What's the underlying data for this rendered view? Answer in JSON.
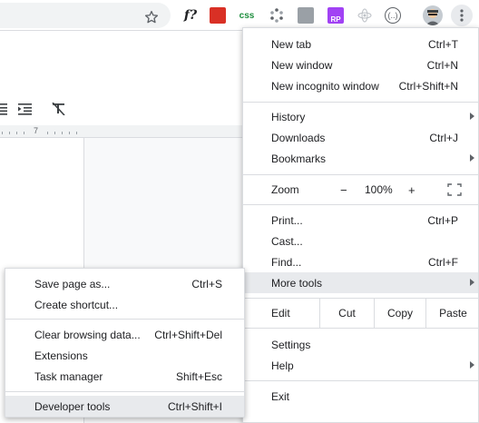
{
  "toolbar": {
    "extensions": [
      {
        "name": "formula-extension-icon",
        "text": "f?"
      },
      {
        "name": "red-book-extension-icon",
        "text": ""
      },
      {
        "name": "css-extension-icon",
        "text": "css"
      },
      {
        "name": "dots-extension-icon",
        "text": ""
      },
      {
        "name": "stack-extension-icon",
        "text": ""
      },
      {
        "name": "rp-extension-icon",
        "text": "RP"
      },
      {
        "name": "atom-extension-icon",
        "text": ""
      },
      {
        "name": "code-extension-icon",
        "text": "(..)"
      }
    ]
  },
  "doc": {
    "ruler_number": "7"
  },
  "menu": {
    "group1": [
      {
        "label": "New tab",
        "accel": "Ctrl+T"
      },
      {
        "label": "New window",
        "accel": "Ctrl+N"
      },
      {
        "label": "New incognito window",
        "accel": "Ctrl+Shift+N"
      }
    ],
    "group2": [
      {
        "label": "History",
        "accel": "",
        "submenu": true
      },
      {
        "label": "Downloads",
        "accel": "Ctrl+J"
      },
      {
        "label": "Bookmarks",
        "accel": "",
        "submenu": true
      }
    ],
    "zoom": {
      "label": "Zoom",
      "minus": "−",
      "value": "100%",
      "plus": "+"
    },
    "group3": [
      {
        "label": "Print...",
        "accel": "Ctrl+P"
      },
      {
        "label": "Cast...",
        "accel": ""
      },
      {
        "label": "Find...",
        "accel": "Ctrl+F"
      },
      {
        "label": "More tools",
        "accel": "",
        "submenu": true,
        "highlight": true
      }
    ],
    "edit": {
      "label": "Edit",
      "cut": "Cut",
      "copy": "Copy",
      "paste": "Paste"
    },
    "group4": [
      {
        "label": "Settings",
        "accel": ""
      },
      {
        "label": "Help",
        "accel": "",
        "submenu": true
      }
    ],
    "exit": {
      "label": "Exit"
    }
  },
  "submenu": {
    "group1": [
      {
        "label": "Save page as...",
        "accel": "Ctrl+S"
      },
      {
        "label": "Create shortcut...",
        "accel": ""
      }
    ],
    "group2": [
      {
        "label": "Clear browsing data...",
        "accel": "Ctrl+Shift+Del"
      },
      {
        "label": "Extensions",
        "accel": ""
      },
      {
        "label": "Task manager",
        "accel": "Shift+Esc"
      }
    ],
    "group3": [
      {
        "label": "Developer tools",
        "accel": "Ctrl+Shift+I",
        "highlight": true
      }
    ]
  },
  "colors": {
    "highlight": "#e8eaed",
    "separator": "#dadce0",
    "text": "#202124"
  }
}
